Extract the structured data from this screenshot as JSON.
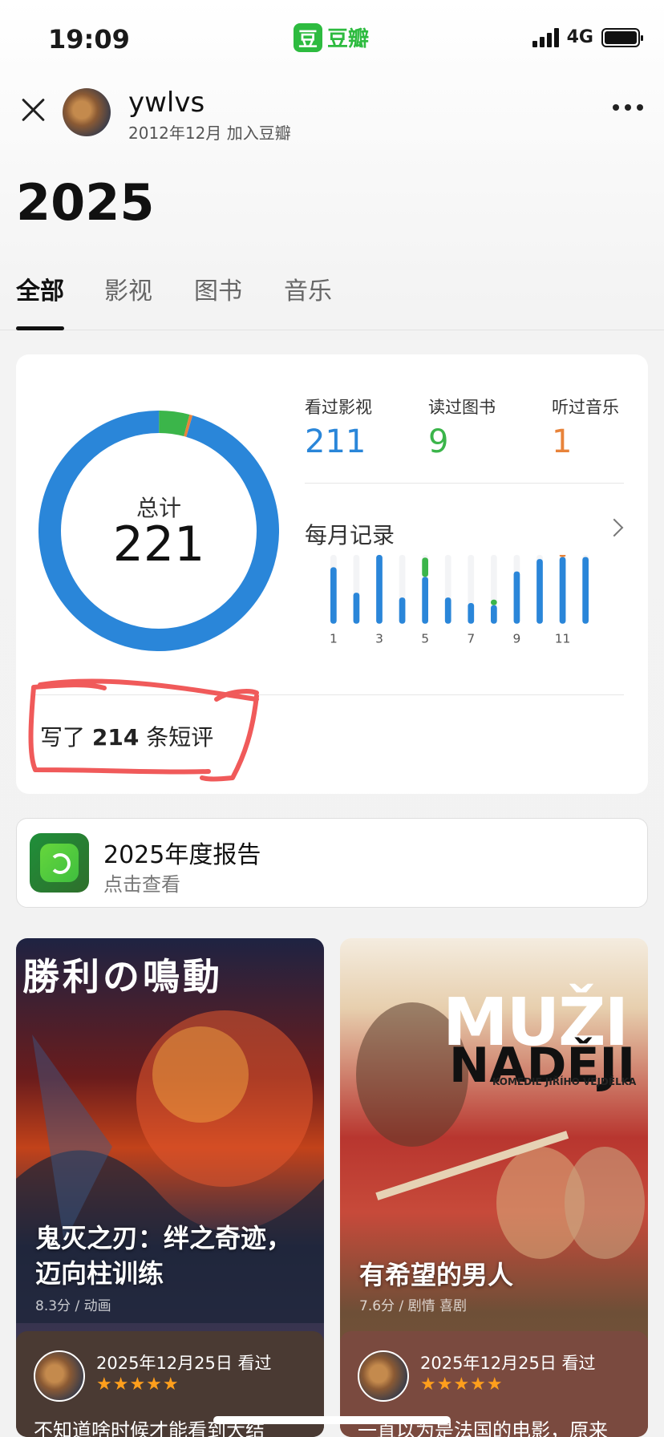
{
  "status_bar": {
    "time": "19:09",
    "app_icon_char": "豆",
    "app_name": "豆瓣",
    "network": "4G"
  },
  "header": {
    "user_name": "ywlvs",
    "join_date": "2012年12月 加入豆瓣"
  },
  "year": "2025",
  "tabs": [
    {
      "label": "全部",
      "active": true
    },
    {
      "label": "影视",
      "active": false
    },
    {
      "label": "图书",
      "active": false
    },
    {
      "label": "音乐",
      "active": false
    }
  ],
  "stats": {
    "total_label": "总计",
    "total_value": "221",
    "items": [
      {
        "label": "看过影视",
        "value": "211",
        "color": "#2a86d9"
      },
      {
        "label": "读过图书",
        "value": "9",
        "color": "#3bb54a"
      },
      {
        "label": "听过音乐",
        "value": "1",
        "color": "#e8833a"
      }
    ],
    "monthly_title": "每月记录",
    "reviews_prefix": "写了",
    "reviews_count": "214",
    "reviews_suffix": "条短评"
  },
  "chart_data": {
    "type": "bar",
    "categories": [
      "1",
      "2",
      "3",
      "4",
      "5",
      "6",
      "7",
      "8",
      "9",
      "10",
      "11",
      "12"
    ],
    "tick_labels": [
      "1",
      "",
      "3",
      "",
      "5",
      "",
      "7",
      "",
      "9",
      "",
      "11",
      ""
    ],
    "series": [
      {
        "name": "影视",
        "color": "#2a86d9",
        "values": [
          0.82,
          0.45,
          1.0,
          0.38,
          0.68,
          0.38,
          0.3,
          0.27,
          0.76,
          0.94,
          0.97,
          0.97
        ]
      },
      {
        "name": "图书",
        "color": "#3bb54a",
        "values": [
          0,
          0,
          0,
          0,
          0.28,
          0,
          0,
          0.08,
          0,
          0,
          0,
          0
        ]
      },
      {
        "name": "音乐",
        "color": "#e8833a",
        "values": [
          0,
          0,
          0,
          0,
          0,
          0,
          0,
          0,
          0,
          0,
          0.04,
          0
        ]
      }
    ],
    "donut": [
      {
        "name": "影视",
        "value": 211,
        "color": "#2a86d9"
      },
      {
        "name": "图书",
        "value": 9,
        "color": "#3bb54a"
      },
      {
        "name": "音乐",
        "value": 1,
        "color": "#e8833a"
      }
    ]
  },
  "report": {
    "title": "2025年度报告",
    "subtitle": "点击查看"
  },
  "movies": [
    {
      "poster_header": "勝利の鳴動",
      "title": "鬼灭之刃：绊之奇迹，迈向柱训练",
      "meta": "8.3分 / 动画",
      "review_date": "2025年12月25日 看过",
      "stars": "★★★★★",
      "review_text": "不知道啥时候才能看到大结"
    },
    {
      "poster_title_1": "MUŽI",
      "poster_title_2": "NADĚJI",
      "poster_subtitle": "KOMEDIE JIŘÍHO VEJDĚLKA",
      "title": "有希望的男人",
      "meta": "7.6分 / 剧情 喜剧",
      "review_date": "2025年12月25日 看过",
      "stars": "★★★★★",
      "review_text": "一直以为是法国的电影，原来"
    }
  ]
}
